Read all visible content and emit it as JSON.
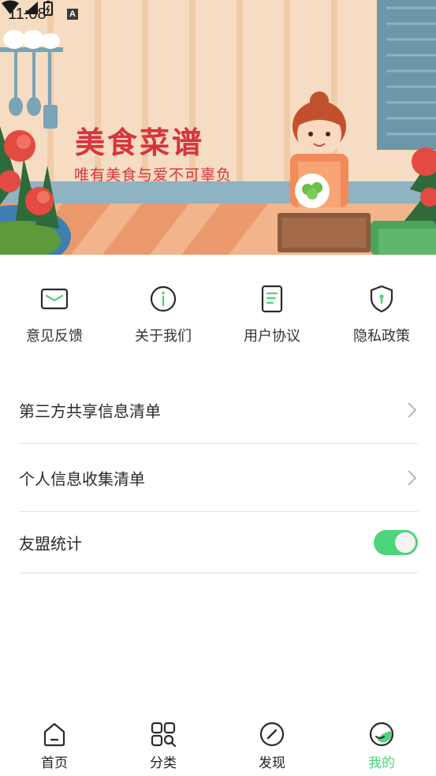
{
  "status_bar": {
    "time": "11:08",
    "notification_badge": "A"
  },
  "banner": {
    "title": "美食菜谱",
    "subtitle": "唯有美食与爱不可辜负",
    "title_color": "#d8343d"
  },
  "quick_actions": [
    {
      "label": "意见反馈",
      "icon": "envelope-icon"
    },
    {
      "label": "关于我们",
      "icon": "info-icon"
    },
    {
      "label": "用户协议",
      "icon": "document-icon"
    },
    {
      "label": "隐私政策",
      "icon": "shield-icon"
    }
  ],
  "settings": {
    "third_party_list": "第三方共享信息清单",
    "personal_info_list": "个人信息收集清单",
    "umeng_stats": "友盟统计",
    "umeng_enabled": true
  },
  "bottom_nav": [
    {
      "label": "首页",
      "icon": "home-icon",
      "active": false
    },
    {
      "label": "分类",
      "icon": "category-icon",
      "active": false
    },
    {
      "label": "发现",
      "icon": "compass-icon",
      "active": false
    },
    {
      "label": "我的",
      "icon": "profile-icon",
      "active": true
    }
  ],
  "colors": {
    "accent": "#4fd47b",
    "divider": "#e3e3e3",
    "text": "#2a2a2a"
  }
}
